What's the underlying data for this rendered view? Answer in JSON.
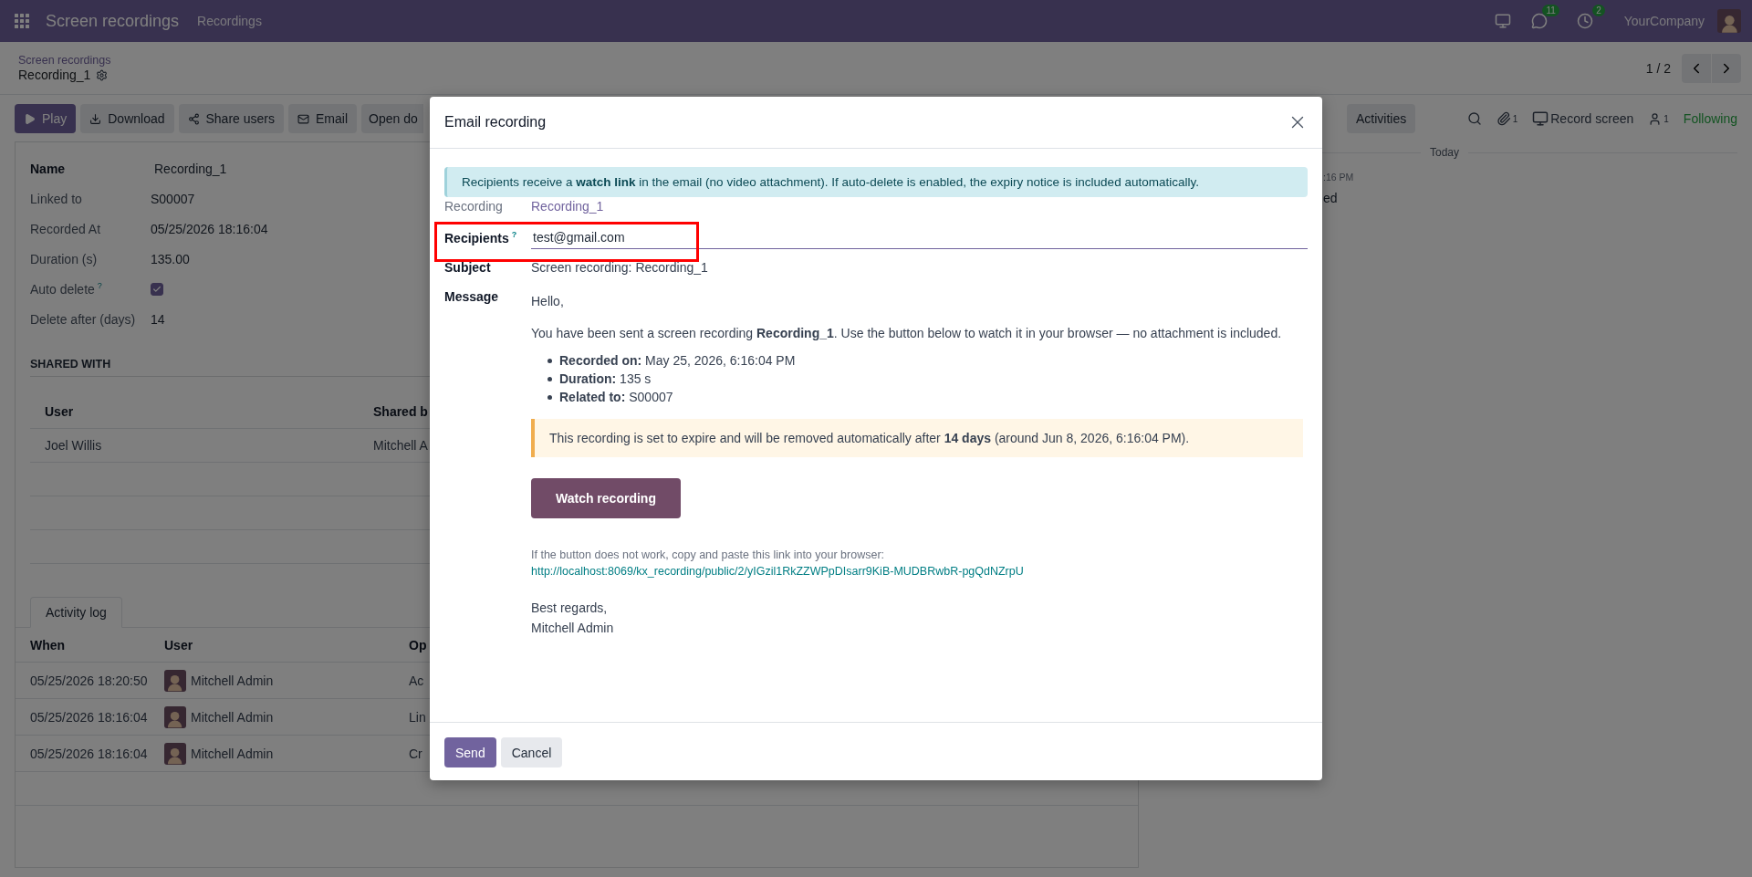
{
  "navbar": {
    "app": "Screen recordings",
    "menu": [
      "Recordings"
    ],
    "chat_count": "11",
    "activity_count": "2",
    "company": "YourCompany"
  },
  "breadcrumb": {
    "parent": "Screen recordings",
    "current": "Recording_1"
  },
  "pager": {
    "value": "1 / 2"
  },
  "actions": [
    {
      "label": "Play",
      "kind": "primary"
    },
    {
      "label": "Download",
      "kind": "secondary"
    },
    {
      "label": "Share users",
      "kind": "secondary"
    },
    {
      "label": "Email",
      "kind": "secondary"
    },
    {
      "label": "Open do",
      "kind": "cut"
    }
  ],
  "chatter_bar": {
    "activities": "Activities",
    "attachments": "1",
    "record": "Record screen",
    "followers": "1",
    "follow": "Following"
  },
  "form": {
    "fields": [
      {
        "label": "Name",
        "value": "Recording_1",
        "kind": "name"
      },
      {
        "label": "Linked to",
        "value": "S00007",
        "kind": "text"
      },
      {
        "label": "Recorded At",
        "value": "05/25/2026 18:16:04",
        "kind": "text"
      },
      {
        "label": "Duration (s)",
        "value": "135.00",
        "kind": "text"
      },
      {
        "label": "Auto delete",
        "help": "?",
        "kind": "checkbox",
        "checked": true
      },
      {
        "label": "Delete after (days)",
        "value": "14",
        "kind": "text"
      }
    ]
  },
  "shared_with": {
    "title": "SHARED WITH",
    "columns": [
      "User",
      "Shared b"
    ],
    "rows": [
      [
        "Joel Willis",
        "Mitchell A"
      ]
    ]
  },
  "activity_log": {
    "tab": "Activity log",
    "columns": [
      "When",
      "User",
      "Op"
    ],
    "rows": [
      {
        "when": "05/25/2026 18:20:50",
        "user": "Mitchell Admin",
        "op": "Ac"
      },
      {
        "when": "05/25/2026 18:16:04",
        "user": "Mitchell Admin",
        "op": "Lin"
      },
      {
        "when": "05/25/2026 18:16:04",
        "user": "Mitchell Admin",
        "op": "Cr"
      }
    ]
  },
  "chatter": {
    "date": "Today",
    "time": ":16 PM",
    "text": "ed"
  },
  "dialog": {
    "title": "Email recording",
    "notice": "Recipients receive a **watch link** in the email (no video attachment). If auto-delete is enabled, the expiry notice is included automatically.",
    "recording": {
      "label": "Recording",
      "value": "Recording_1"
    },
    "recipients": {
      "label": "Recipients",
      "help": "?",
      "value": "test@gmail.com",
      "highlighted": true
    },
    "subject": {
      "label": "Subject",
      "value": "Screen recording: Recording_1"
    },
    "message": {
      "label": "Message",
      "greeting": "Hello,",
      "intro": "You have been sent a screen recording **Recording_1**. Use the button below to watch it in your browser — no attachment is included.",
      "details": [
        "**Recorded on:** May 25, 2026, 6:16:04 PM",
        "**Duration:** 135 s",
        "**Related to:** S00007"
      ],
      "warning": "This recording is set to expire and will be removed automatically after **14 days** (around Jun 8, 2026, 6:16:04 PM).",
      "button": "Watch recording",
      "fallback": "If the button does not work, copy and paste this link into your browser:",
      "link": "http://localhost:8069/kx_recording/public/2/yIGzil1RkZZWPpDIsarr9KiB-MUDBRwbR-pgQdNZrpU",
      "closing": "Best regards,",
      "signature": "Mitchell Admin"
    },
    "buttons": [
      {
        "label": "Send",
        "kind": "primary"
      },
      {
        "label": "Cancel",
        "kind": "secondary"
      }
    ]
  }
}
